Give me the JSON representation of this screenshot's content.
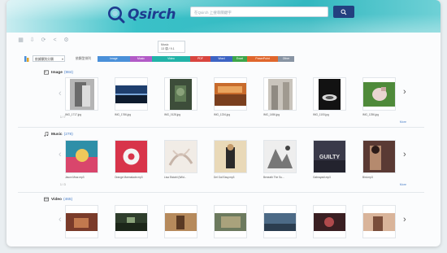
{
  "header": {
    "logo_text": "Qsirch",
    "search_placeholder": "在Qsirch 上搜尋關鍵字",
    "colors": {
      "brand": "#1d3b8f",
      "header": "#33b8c0"
    }
  },
  "toolbar": {
    "icons": [
      "grid-view-icon",
      "download-icon",
      "refresh-icon",
      "share-icon",
      "settings-icon"
    ]
  },
  "tooltip": {
    "line1": "Music",
    "line2": "13 項 / 9.1"
  },
  "filter": {
    "select_label": "依據類別分類",
    "label": "依類型排列",
    "types": [
      {
        "label": "Image",
        "color": "#4a90d9"
      },
      {
        "label": "Music",
        "color": "#b25bc7"
      },
      {
        "label": "Video",
        "color": "#22b3a8"
      },
      {
        "label": "PDF",
        "color": "#d9453f"
      },
      {
        "label": "Word",
        "color": "#3d64c4"
      },
      {
        "label": "Excel",
        "color": "#3da64a"
      },
      {
        "label": "PowerPoint",
        "color": "#e0662c"
      },
      {
        "label": "Other",
        "color": "#8894a3"
      }
    ]
  },
  "sections": {
    "image": {
      "title": "Image",
      "count": "(984)",
      "pager": "1 / 7",
      "more": "More",
      "items": [
        "IMG_1717.jpg",
        "IMG_1766.jpg",
        "IMG_0128.jpg",
        "IMG_1234.jpg",
        "IMG_1456.jpg",
        "IMG_1100.jpg",
        "IMG_1256.jpg"
      ]
    },
    "music": {
      "title": "Music",
      "count": "(278)",
      "pager": "1 / 3",
      "more": "More",
      "items": [
        "Jason Mraz.mp3",
        "Orange Marmalade.mp3",
        "Lisa Ekdahl (Wild...",
        "Del Gal Easy.mp3",
        "Beneath The Su...",
        "Gabrayadi.mp3",
        "Bird.mp3"
      ],
      "cover_text": "GUILTY"
    },
    "video": {
      "title": "Video",
      "count": "(465)"
    }
  }
}
